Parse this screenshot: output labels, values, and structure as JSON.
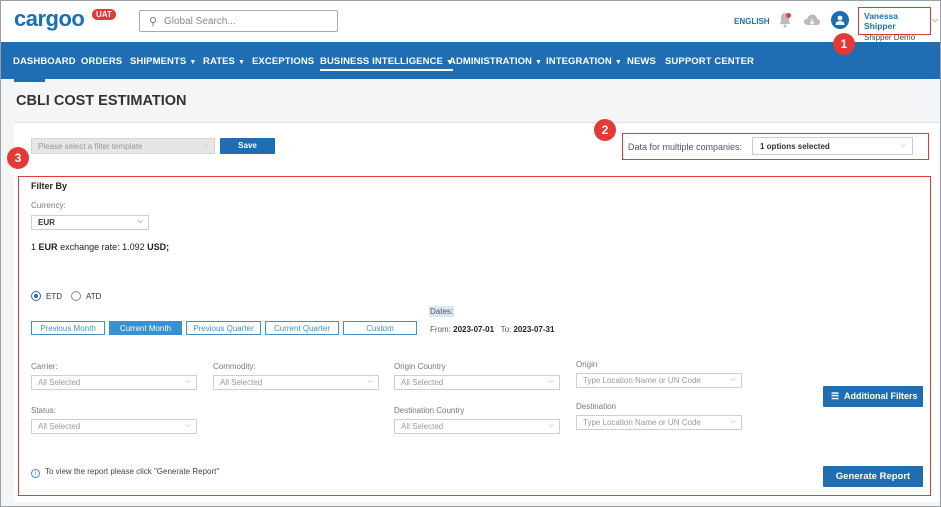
{
  "header": {
    "logo_text": "cargoo",
    "env_badge": "UAT",
    "search_placeholder": "Global Search...",
    "language": "ENGLISH",
    "user_name": "Vanessa Shipper",
    "user_company": "Shipper Demo"
  },
  "nav": [
    {
      "label": "DASHBOARD",
      "has_caret": false
    },
    {
      "label": "ORDERS",
      "has_caret": false
    },
    {
      "label": "SHIPMENTS",
      "has_caret": true
    },
    {
      "label": "RATES",
      "has_caret": true
    },
    {
      "label": "EXCEPTIONS",
      "has_caret": false
    },
    {
      "label": "BUSINESS INTELLIGENCE",
      "has_caret": true,
      "active": true
    },
    {
      "label": "ADMINISTRATION",
      "has_caret": true
    },
    {
      "label": "INTEGRATION",
      "has_caret": true
    },
    {
      "label": "NEWS",
      "has_caret": false
    },
    {
      "label": "SUPPORT CENTER",
      "has_caret": false
    }
  ],
  "page_title": "CBLI COST ESTIMATION",
  "template": {
    "placeholder": "Please select a filter template",
    "save_label": "Save"
  },
  "multi_company": {
    "label": "Data for multiple companies:",
    "value": "1 options selected"
  },
  "filters": {
    "title": "Filter By",
    "currency_label": "Currency:",
    "currency_value": "EUR",
    "rate_prefix": "1",
    "rate_currency": "EUR",
    "rate_text": "exchange rate: 1.092",
    "rate_target": "USD;",
    "radio_etd": "ETD",
    "radio_atd": "ATD",
    "selected_radio": "ETD",
    "periods": [
      "Previous Month",
      "Current Month",
      "Previous Quarter",
      "Current Quarter",
      "Custom"
    ],
    "active_period": "Current Month",
    "dates_label": "Dates:",
    "from_label": "From:",
    "from_value": "2023-07-01",
    "to_label": "To:",
    "to_value": "2023-07-31",
    "carrier_label": "Carrier:",
    "carrier_value": "All Selected",
    "commodity_label": "Commodity:",
    "commodity_value": "All Selected",
    "origin_country_label": "Origin Country",
    "origin_country_value": "All Selected",
    "origin_label": "Origin",
    "origin_placeholder": "Type Location Name or UN Code",
    "status_label": "Status:",
    "status_value": "All Selected",
    "destination_country_label": "Destination Country",
    "destination_country_value": "All Selected",
    "destination_label": "Destination",
    "destination_placeholder": "Type Location Name or UN Code",
    "additional_filters_label": "Additional Filters",
    "generate_label": "Generate Report",
    "info_text": "To view the report please click \"Generate Report\""
  },
  "annotations": [
    "1",
    "2",
    "3"
  ],
  "colors": {
    "brand": "#1f6db3",
    "accent_light": "#3a91d1",
    "highlight_red": "#e53935"
  }
}
